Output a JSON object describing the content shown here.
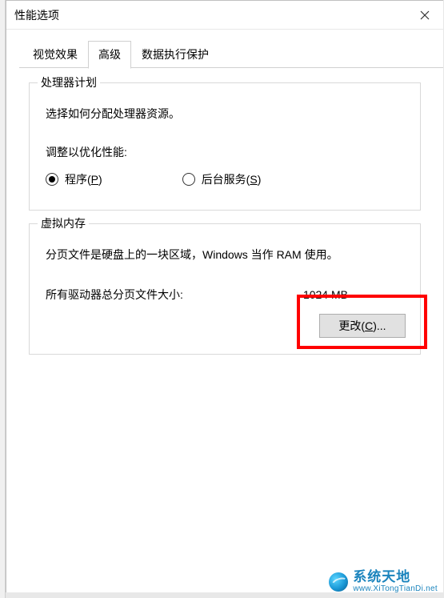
{
  "window": {
    "title": "性能选项"
  },
  "tabs": {
    "visual": "视觉效果",
    "advanced": "高级",
    "dep": "数据执行保护"
  },
  "processor": {
    "legend": "处理器计划",
    "desc": "选择如何分配处理器资源。",
    "optimize_label": "调整以优化性能:",
    "radio_programs_prefix": "程序(",
    "radio_programs_key": "P",
    "radio_programs_suffix": ")",
    "radio_services_prefix": "后台服务(",
    "radio_services_key": "S",
    "radio_services_suffix": ")"
  },
  "vm": {
    "legend": "虚拟内存",
    "desc": "分页文件是硬盘上的一块区域，Windows 当作 RAM 使用。",
    "total_label": "所有驱动器总分页文件大小:",
    "total_value": "1024 MB",
    "change_prefix": "更改(",
    "change_key": "C",
    "change_suffix": ")..."
  },
  "watermark": {
    "cn": "系统天地",
    "en": "www.XiTongTianDi.net"
  }
}
